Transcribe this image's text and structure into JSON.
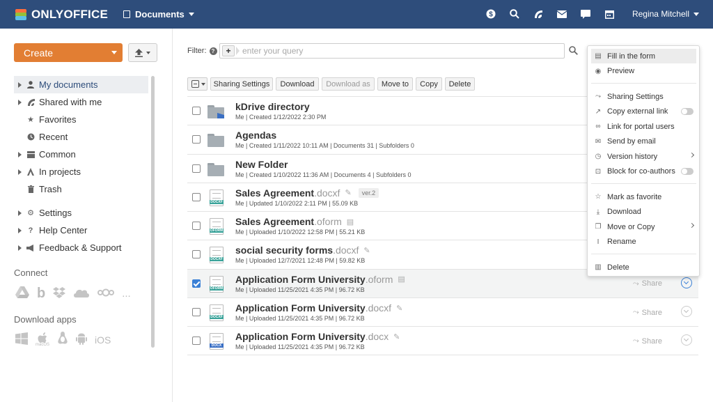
{
  "header": {
    "logo_text": "ONLYOFFICE",
    "module_title": "Documents",
    "user_name": "Regina Mitchell",
    "icons": [
      "payments-icon",
      "search-icon",
      "feed-icon",
      "mail-icon",
      "chat-icon",
      "calendar-icon"
    ],
    "background": "#2e4d7b"
  },
  "left": {
    "create_label": "Create",
    "nav": [
      {
        "label": "My documents",
        "icon": "user-icon",
        "expand": true,
        "active": true
      },
      {
        "label": "Shared with me",
        "icon": "share-icon",
        "expand": true
      },
      {
        "label": "Favorites",
        "icon": "star-icon",
        "expand": false
      },
      {
        "label": "Recent",
        "icon": "clock-icon",
        "expand": false
      },
      {
        "label": "Common",
        "icon": "common-icon",
        "expand": true
      },
      {
        "label": "In projects",
        "icon": "projects-icon",
        "expand": true
      },
      {
        "label": "Trash",
        "icon": "trash-icon",
        "expand": false
      }
    ],
    "settings_label": "Settings",
    "help_label": "Help Center",
    "feedback_label": "Feedback & Support",
    "connect_title": "Connect",
    "connect_more": "...",
    "apps_title": "Download apps",
    "apps_ios": "iOS",
    "apps_macos": "macOS"
  },
  "filter": {
    "label": "Filter:",
    "placeholder": "enter your query"
  },
  "toolbar": {
    "sharing": "Sharing Settings",
    "download": "Download",
    "download_as": "Download as",
    "move_to": "Move to",
    "copy": "Copy",
    "delete": "Delete"
  },
  "files": [
    {
      "name": "kDrive directory",
      "ext": "",
      "meta": "Me | Created 1/12/2022 2:30 PM",
      "kind": "folder-shared"
    },
    {
      "name": "Agendas",
      "ext": "",
      "meta": "Me | Created 1/11/2022 10:11 AM | Documents 31 | Subfolders 0",
      "kind": "folder"
    },
    {
      "name": "New Folder",
      "ext": "",
      "meta": "Me | Created 1/10/2022 11:36 AM | Documents 4 | Subfolders 0",
      "kind": "folder"
    },
    {
      "name": "Sales Agreement",
      "ext": ".docxf",
      "meta": "Me | Updated 1/10/2022 2:11 PM | 55.09 KB",
      "kind": "docxf",
      "version": "ver.2"
    },
    {
      "name": "Sales Agreement",
      "ext": ".oform",
      "meta": "Me | Uploaded 1/10/2022 12:58 PM | 55.21 KB",
      "kind": "oform"
    },
    {
      "name": "social security forms",
      "ext": ".docxf",
      "meta": "Me | Uploaded 12/7/2021 12:48 PM | 59.82 KB",
      "kind": "docxf"
    },
    {
      "name": "Application Form University",
      "ext": ".oform",
      "meta": "Me | Uploaded 11/25/2021 4:35 PM | 96.72 KB",
      "kind": "oform",
      "checked": true,
      "share": "Share",
      "menu_active": true
    },
    {
      "name": "Application Form University",
      "ext": ".docxf",
      "meta": "Me | Uploaded 11/25/2021 4:35 PM | 96.72 KB",
      "kind": "docxf",
      "share": "Share"
    },
    {
      "name": "Application Form University",
      "ext": ".docx",
      "meta": "Me | Uploaded 11/25/2021 4:35 PM | 96.72 KB",
      "kind": "docx",
      "share": "Share"
    }
  ],
  "context_menu": {
    "items": [
      {
        "label": "Fill in the form",
        "icon": "form-icon",
        "highlight": true
      },
      {
        "label": "Preview",
        "icon": "eye-icon"
      },
      {
        "sep": true
      },
      {
        "label": "Sharing Settings",
        "icon": "share-icon"
      },
      {
        "label": "Copy external link",
        "icon": "external-link-icon",
        "toggle": true
      },
      {
        "label": "Link for portal users",
        "icon": "link-icon"
      },
      {
        "label": "Send by email",
        "icon": "mail-icon"
      },
      {
        "label": "Version history",
        "icon": "history-icon",
        "submenu": true
      },
      {
        "label": "Block for co-authors",
        "icon": "lock-icon",
        "toggle": true
      },
      {
        "sep": true
      },
      {
        "label": "Mark as favorite",
        "icon": "star-icon"
      },
      {
        "label": "Download",
        "icon": "download-icon"
      },
      {
        "label": "Move or Copy",
        "icon": "copy-icon",
        "submenu": true
      },
      {
        "label": "Rename",
        "icon": "rename-icon"
      },
      {
        "sep": true
      },
      {
        "label": "Delete",
        "icon": "trash-icon"
      }
    ]
  },
  "colors": {
    "accent": "#e27e33",
    "link": "#2e4d7b",
    "checkbox": "#3a80d6",
    "docx_tag": "#3a6fc4",
    "oform_tag": "#3aa39a",
    "docxf_tag": "#3aa39a"
  }
}
